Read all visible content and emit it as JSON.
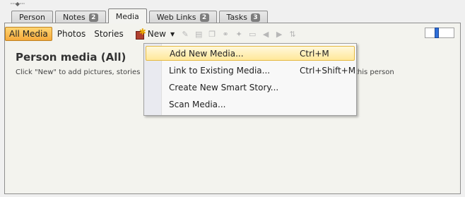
{
  "tabs": [
    {
      "label": "Person",
      "badge": ""
    },
    {
      "label": "Notes",
      "badge": "2"
    },
    {
      "label": "Media",
      "badge": ""
    },
    {
      "label": "Web Links",
      "badge": "2"
    },
    {
      "label": "Tasks",
      "badge": "3"
    }
  ],
  "active_tab": "Media",
  "toolbar": {
    "filters": [
      "All Media",
      "Photos",
      "Stories"
    ],
    "active_filter": "All Media",
    "new_label": "New",
    "icons": [
      "edit-icon",
      "properties-icon",
      "copy-icon",
      "link-icon",
      "tag-icon",
      "slideshow-icon",
      "previous-icon",
      "next-icon",
      "sort-icon"
    ]
  },
  "content": {
    "heading": "Person media (All)",
    "hint_start": "Click \"New\" to add pictures, stories",
    "hint_end": "this person"
  },
  "menu": {
    "items": [
      {
        "label": "Add New Media...",
        "shortcut": "Ctrl+M",
        "highlighted": true
      },
      {
        "label": "Link to Existing Media...",
        "shortcut": "Ctrl+Shift+M",
        "highlighted": false
      },
      {
        "label": "Create New Smart Story...",
        "shortcut": "",
        "highlighted": false
      },
      {
        "label": "Scan Media...",
        "shortcut": "",
        "highlighted": false
      }
    ]
  },
  "zoom_slider": {
    "level": 0.35
  },
  "colors": {
    "highlight": "#ffe89a",
    "active_filter": "#f5a93a",
    "slider_thumb": "#2f6fd8"
  }
}
